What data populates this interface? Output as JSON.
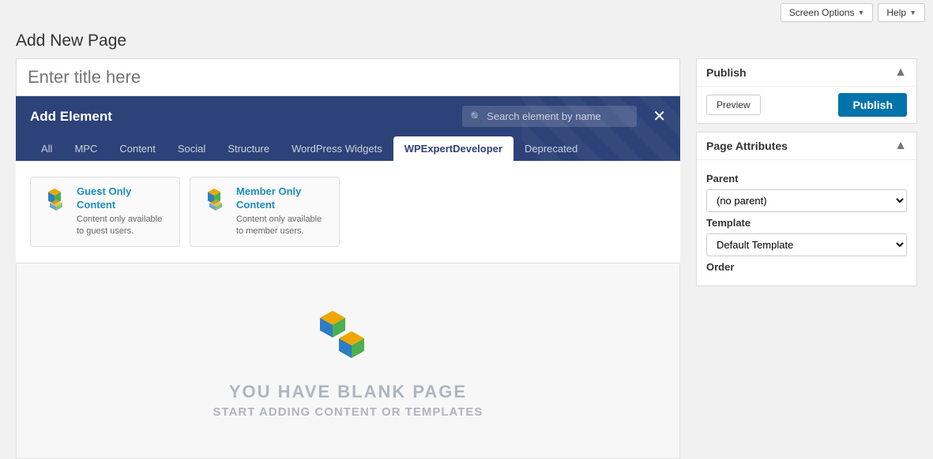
{
  "topbar": {
    "screen_options_label": "Screen Options",
    "help_label": "Help"
  },
  "page": {
    "title": "Add New Page",
    "title_placeholder": "Enter title here"
  },
  "add_element": {
    "title": "Add Element",
    "search_placeholder": "Search element by name",
    "tabs": [
      {
        "id": "all",
        "label": "All",
        "active": false
      },
      {
        "id": "mpc",
        "label": "MPC",
        "active": false
      },
      {
        "id": "content",
        "label": "Content",
        "active": false
      },
      {
        "id": "social",
        "label": "Social",
        "active": false
      },
      {
        "id": "structure",
        "label": "Structure",
        "active": false
      },
      {
        "id": "wordpress_widgets",
        "label": "WordPress Widgets",
        "active": false
      },
      {
        "id": "wpexpertdeveloper",
        "label": "WPExpertDeveloper",
        "active": true
      },
      {
        "id": "deprecated",
        "label": "Deprecated",
        "active": false
      }
    ],
    "elements": [
      {
        "name": "Guest Only Content",
        "description": "Content only available to guest users."
      },
      {
        "name": "Member Only Content",
        "description": "Content only available to member users."
      }
    ]
  },
  "blank_page": {
    "line1": "YOU HAVE BLANK PAGE",
    "line2": "START ADDING CONTENT OR TEMPLATES"
  },
  "publish_box": {
    "title": "Publish",
    "preview_label": "Preview",
    "publish_label": "Publish"
  },
  "page_attributes": {
    "title": "Page Attributes",
    "parent_label": "Parent",
    "parent_default": "(no parent)",
    "template_label": "Template",
    "template_default": "Default Template",
    "order_label": "Order"
  }
}
